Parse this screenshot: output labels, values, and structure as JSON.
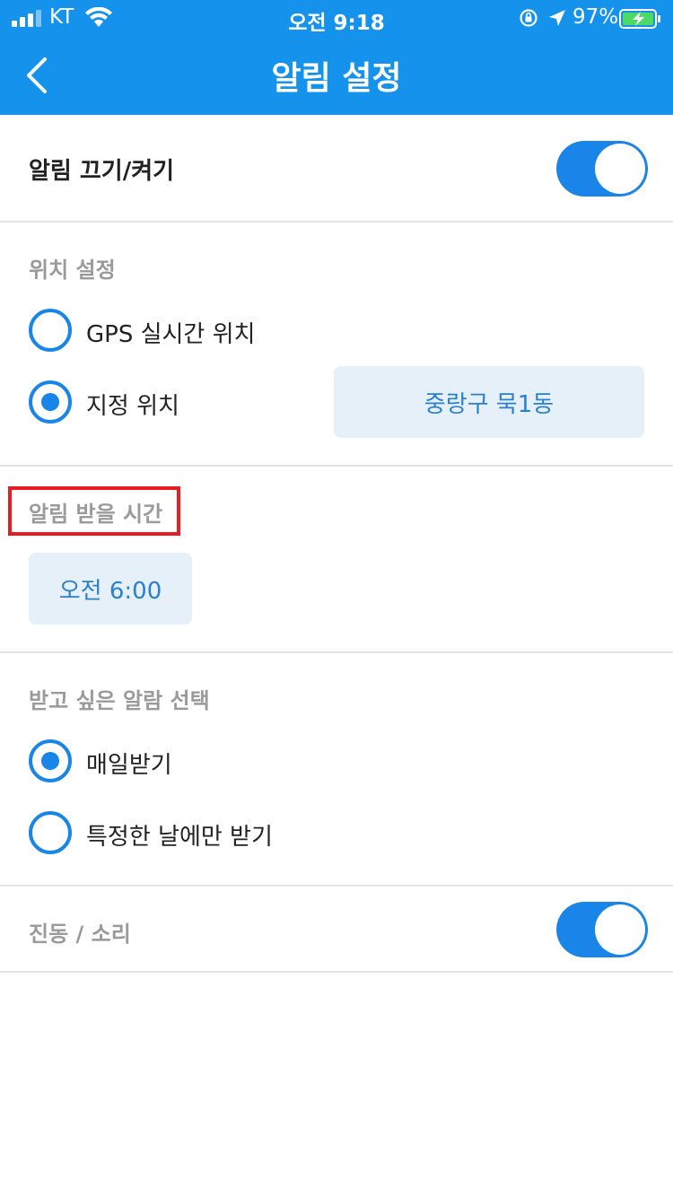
{
  "status_bar": {
    "carrier": "KT",
    "time": "오전 9:18",
    "battery_percent": "97%",
    "icons": [
      "signal-icon",
      "wifi-icon",
      "rotation-lock-icon",
      "location-icon",
      "battery-charging-icon"
    ]
  },
  "nav": {
    "title": "알림 설정",
    "back_icon": "chevron-left-icon"
  },
  "alarm_toggle": {
    "label": "알림 끄기/켜기",
    "on": true
  },
  "location": {
    "header": "위치 설정",
    "options": [
      {
        "label": "GPS 실시간 위치",
        "selected": false
      },
      {
        "label": "지정 위치",
        "selected": true
      }
    ],
    "designated_location": "중랑구 묵1동"
  },
  "alarm_time": {
    "header": "알림 받을 시간",
    "value": "오전 6:00"
  },
  "alarm_type": {
    "header": "받고 싶은 알람 선택",
    "options": [
      {
        "label": "매일받기",
        "selected": true
      },
      {
        "label": "특정한 날에만 받기",
        "selected": false
      }
    ]
  },
  "vibration_sound": {
    "label": "진동 / 소리",
    "on": true
  },
  "colors": {
    "header_blue": "#1592ec",
    "accent_blue": "#1a85e9",
    "pill_bg": "#e6f0f8",
    "highlight_red": "#e81d24"
  }
}
